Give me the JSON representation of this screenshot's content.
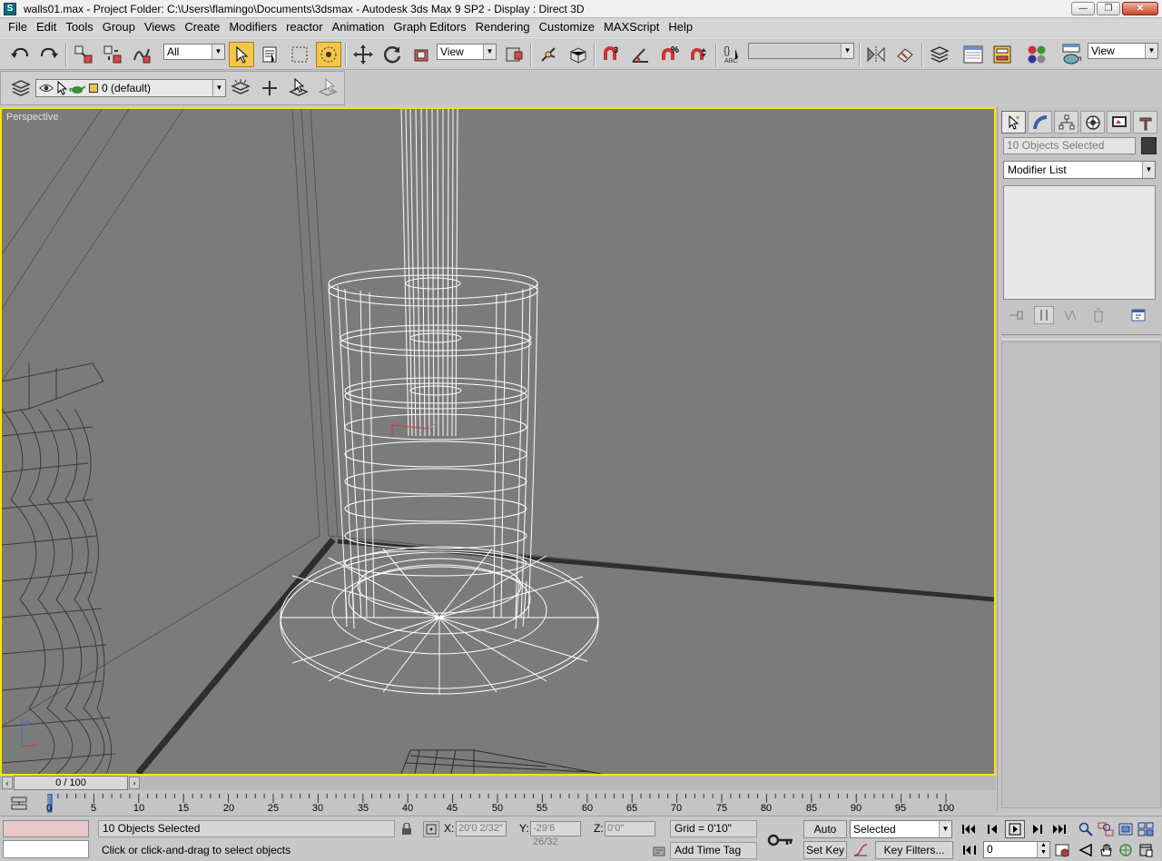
{
  "window": {
    "title": "walls01.max    - Project Folder: C:\\Users\\flamingo\\Documents\\3dsmax      - Autodesk 3ds Max 9 SP2      - Display : Direct 3D",
    "minimize": "—",
    "maximize": "❐",
    "close": "✕"
  },
  "menu": [
    "File",
    "Edit",
    "Tools",
    "Group",
    "Views",
    "Create",
    "Modifiers",
    "reactor",
    "Animation",
    "Graph Editors",
    "Rendering",
    "Customize",
    "MAXScript",
    "Help"
  ],
  "toolbar": {
    "selection_filter": "All",
    "ref_coord": "View",
    "named_selection": "",
    "view_dropdown": "View"
  },
  "layerbar": {
    "layer_name": "0 (default)"
  },
  "viewport": {
    "label": "Perspective",
    "border_color": "#f5e600"
  },
  "cmdpanel": {
    "selection_name": "10 Objects Selected",
    "modifier_list": "Modifier List"
  },
  "timeline": {
    "frame_display": "0 / 100",
    "ticks": [
      "0",
      "5",
      "10",
      "15",
      "20",
      "25",
      "30",
      "35",
      "40",
      "45",
      "50",
      "55",
      "60",
      "65",
      "70",
      "75",
      "80",
      "85",
      "90",
      "95",
      "100"
    ]
  },
  "status": {
    "selection": "10 Objects Selected",
    "prompt": "Click or click-and-drag to select objects",
    "x_label": "X:",
    "x_value": "20'0 2/32\"",
    "y_label": "Y:",
    "y_value": "-29'6 26/32",
    "z_label": "Z:",
    "z_value": "0'0\"",
    "grid": "Grid = 0'10\"",
    "add_time_tag": "Add Time Tag",
    "auto_key": "Auto Key",
    "set_key": "Set Key",
    "key_mode": "Selected",
    "key_filters": "Key Filters...",
    "current_frame": "0"
  }
}
